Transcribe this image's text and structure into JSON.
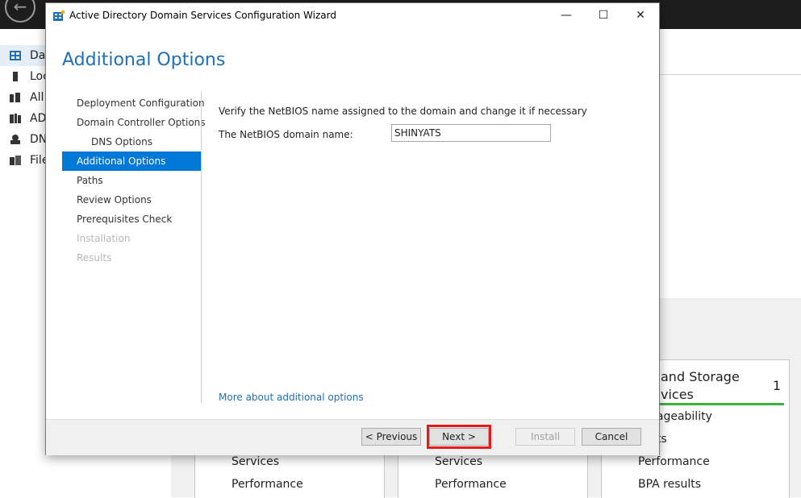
{
  "background": {
    "back_arrow": "←",
    "nav_items": [
      {
        "label": "Das",
        "icon": "dashboard-icon"
      },
      {
        "label": "Loc",
        "icon": "server-icon"
      },
      {
        "label": "All",
        "icon": "servers-icon"
      },
      {
        "label": "AD",
        "icon": "ad-icon"
      },
      {
        "label": "DN",
        "icon": "dns-icon"
      },
      {
        "label": "File",
        "icon": "file-services-icon"
      }
    ],
    "mark": ",",
    "cards": [
      {
        "items": [
          "Services",
          "Performance"
        ]
      },
      {
        "items": [
          "Services",
          "Performance"
        ]
      }
    ],
    "storage_card": {
      "title_line1": "and Storage",
      "title_line2": "vices",
      "count": "1",
      "items": [
        "nageability",
        "nts",
        "Performance",
        "BPA results"
      ]
    }
  },
  "dialog": {
    "title": "Active Directory Domain Services Configuration Wizard",
    "minimize": "—",
    "maximize": "☐",
    "close": "✕",
    "page_title": "Additional Options",
    "steps": [
      {
        "label": "Deployment Configuration",
        "state": "normal"
      },
      {
        "label": "Domain Controller Options",
        "state": "normal"
      },
      {
        "label": "DNS Options",
        "state": "sub"
      },
      {
        "label": "Additional Options",
        "state": "active"
      },
      {
        "label": "Paths",
        "state": "normal"
      },
      {
        "label": "Review Options",
        "state": "normal"
      },
      {
        "label": "Prerequisites Check",
        "state": "normal"
      },
      {
        "label": "Installation",
        "state": "disabled"
      },
      {
        "label": "Results",
        "state": "disabled"
      }
    ],
    "description": "Verify the NetBIOS name assigned to the domain and change it if necessary",
    "netbios_label": "The NetBIOS domain name:",
    "netbios_value": "SHINYATS",
    "more_link": "More about additional options",
    "buttons": {
      "previous": "< Previous",
      "next": "Next >",
      "install": "Install",
      "cancel": "Cancel"
    },
    "highlight_color": "#e81818",
    "accent_color": "#0078d7"
  }
}
